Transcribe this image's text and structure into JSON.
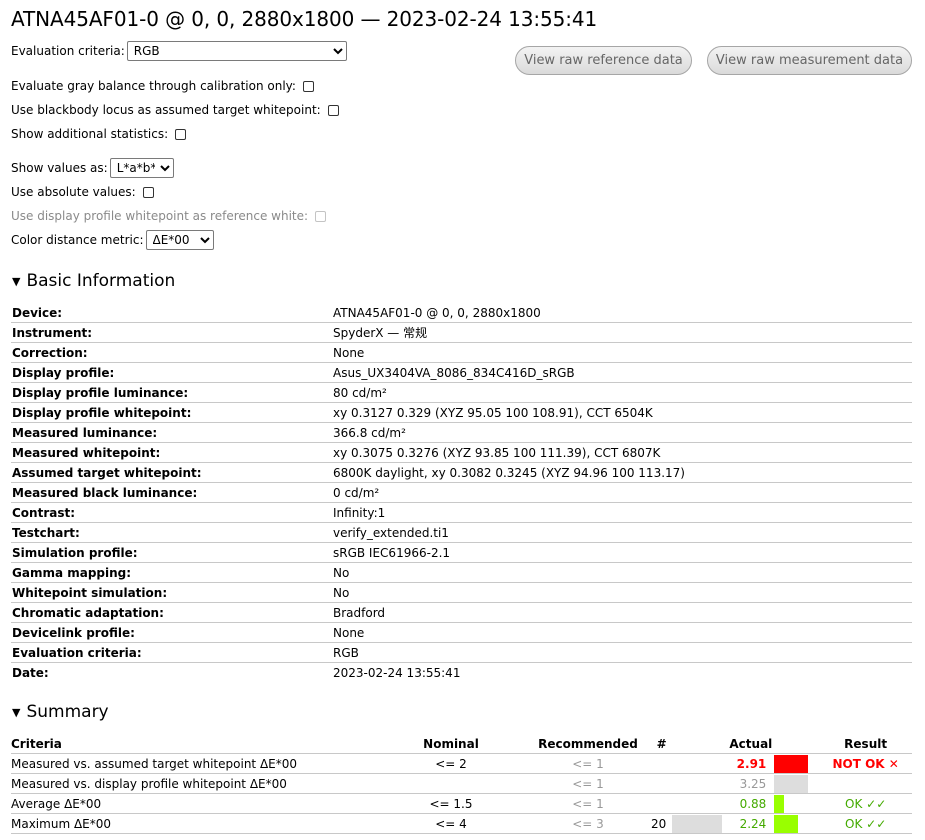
{
  "title": "ATNA45AF01-0 @ 0, 0, 2880x1800 — 2023-02-24 13:55:41",
  "controls": {
    "evaluation_criteria_label": "Evaluation criteria:",
    "evaluation_criteria_value": "RGB",
    "gray_balance_label": "Evaluate gray balance through calibration only:",
    "blackbody_label": "Use blackbody locus as assumed target whitepoint:",
    "additional_stats_label": "Show additional statistics:",
    "show_values_label": "Show values as:",
    "show_values_value": "L*a*b*",
    "absolute_values_label": "Use absolute values:",
    "profile_whitepoint_label": "Use display profile whitepoint as reference white:",
    "color_distance_label": "Color distance metric:",
    "color_distance_value": "ΔE*00"
  },
  "buttons": {
    "raw_reference": "View raw reference data",
    "raw_measurement": "View raw measurement data"
  },
  "basic_info": {
    "heading": "Basic Information",
    "toggle": "▼",
    "rows": [
      {
        "key": "Device:",
        "value": "ATNA45AF01-0 @ 0, 0, 2880x1800"
      },
      {
        "key": "Instrument:",
        "value": "SpyderX — 常规"
      },
      {
        "key": "Correction:",
        "value": "None"
      },
      {
        "key": "Display profile:",
        "value": "Asus_UX3404VA_8086_834C416D_sRGB"
      },
      {
        "key": "Display profile luminance:",
        "value": "80 cd/m²"
      },
      {
        "key": "Display profile whitepoint:",
        "value": "xy 0.3127 0.329 (XYZ 95.05 100 108.91), CCT 6504K"
      },
      {
        "key": "Measured luminance:",
        "value": "366.8 cd/m²"
      },
      {
        "key": "Measured whitepoint:",
        "value": "xy 0.3075 0.3276 (XYZ 93.85 100 111.39), CCT 6807K"
      },
      {
        "key": "Assumed target whitepoint:",
        "value": "6800K daylight, xy 0.3082 0.3245 (XYZ 94.96 100 113.17)"
      },
      {
        "key": "Measured black luminance:",
        "value": "0 cd/m²"
      },
      {
        "key": "Contrast:",
        "value": "Infinity:1"
      },
      {
        "key": "Testchart:",
        "value": "verify_extended.ti1"
      },
      {
        "key": "Simulation profile:",
        "value": "sRGB IEC61966-2.1"
      },
      {
        "key": "Gamma mapping:",
        "value": "No"
      },
      {
        "key": "Whitepoint simulation:",
        "value": "No"
      },
      {
        "key": "Chromatic adaptation:",
        "value": "Bradford"
      },
      {
        "key": "Devicelink profile:",
        "value": "None"
      },
      {
        "key": "Evaluation criteria:",
        "value": "RGB"
      },
      {
        "key": "Date:",
        "value": "2023-02-24 13:55:41"
      }
    ]
  },
  "summary": {
    "heading": "Summary",
    "toggle": "▼",
    "headers": {
      "criteria": "Criteria",
      "nominal": "Nominal",
      "recommended": "Recommended",
      "count": "#",
      "actual": "Actual",
      "result": "Result"
    },
    "colors": {
      "fail": "#ff0000",
      "pass": "#99ff00",
      "neutral": "#dddddd",
      "fail_text": "#ff0000",
      "pass_text": "#44aa00"
    },
    "rows": [
      {
        "criteria": "Measured vs. assumed target whitepoint ΔE*00",
        "nominal": "<= 2",
        "recommended": "<= 1",
        "count": "",
        "actual": "2.91",
        "bar_fraction": 1.0,
        "bar_color": "#ff0000",
        "result": "NOT OK ✕",
        "status": "fail"
      },
      {
        "criteria": "Measured vs. display profile whitepoint ΔE*00",
        "nominal": "",
        "recommended": "<= 1",
        "count": "",
        "actual": "3.25",
        "bar_fraction": 1.0,
        "bar_color": "#dddddd",
        "result": "",
        "status": "neutral"
      },
      {
        "criteria": "Average ΔE*00",
        "nominal": "<= 1.5",
        "recommended": "<= 1",
        "count": "",
        "actual": "0.88",
        "bar_fraction": 0.3,
        "bar_color": "#99ff00",
        "result": "OK ✓✓",
        "status": "pass"
      },
      {
        "criteria": "Maximum ΔE*00",
        "nominal": "<= 4",
        "recommended": "<= 3",
        "count": "20",
        "actual": "2.24",
        "bar_fraction": 0.72,
        "bar_color": "#99ff00",
        "result": "OK ✓✓",
        "status": "pass"
      }
    ]
  }
}
